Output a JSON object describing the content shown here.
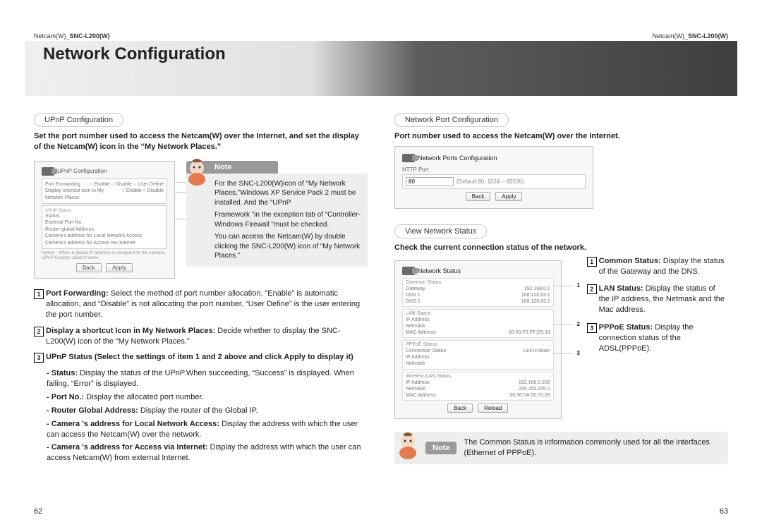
{
  "header": {
    "left_prefix": "Netcam(W)_",
    "left_model": "SNC-L200(W)",
    "right_prefix": "Netcam(W)_",
    "right_model": "SNC-L200(W)"
  },
  "banner": {
    "title": "Network Configuration"
  },
  "left": {
    "section_title": "UPnP Configuration",
    "intro": "Set the port number used to access the Netcam(W) over the Internet, and set the display of the Netcam(W) icon in the “My Network Places.”",
    "panel": {
      "title": "UPnP Configuration",
      "row1_l": "Port Forwarding",
      "row1_r": "○ Enable  ○ Disable  ○ User Define",
      "row2_l": "Display shortcut icon in My Network Places",
      "row2_r": "○ Enable  ○ Disable",
      "status_title": "UPnP Status",
      "s1": "Status",
      "s2": "External Port No.",
      "s3": "Router global Address",
      "s4": "Camera's address for Local Network Access",
      "s5": "Camera's address for Access via Internet",
      "notice": "Notice : When a global IP address is assigned to the camera, UPnP function doesn't work.",
      "btn_back": "Back",
      "btn_apply": "Apply"
    },
    "note": {
      "label": "Note",
      "p1": "For the SNC-L200(W)icon of “My Network Places,”Windows XP Service Pack 2 must be installed. And the “UPnP",
      "p2": "Framework ”in the exception tab of “Controller-Windows Firewall ”must be checked.",
      "p3": "You can access the Netcam(W) by double clicking the SNC-L200(W) icon of “My Network Places.”"
    },
    "list": {
      "i1_b": "Port Forwarding:",
      "i1_t": " Select the method of port number allocation. “Enable” is automatic allocation, and “Disable” is not allocating the port number. “User Define” is the user entering the port number.",
      "i2_b": "Display a shortcut Icon in My Network Places:",
      "i2_t": " Decide whether to display the SNC-L200(W) icon of the “My Network Places.”",
      "i3_b": "UPnP Status (Select the settings of item 1 and 2 above and click Apply to display it)",
      "s1_b": "Status:",
      "s1_t": " Display the status of the UPnP.When succeeding, “Success” is displayed. When failing, “Error” is displayed.",
      "s2_b": "Port No.:",
      "s2_t": " Display the allocated port number.",
      "s3_b": "Router Global Address:",
      "s3_t": " Display the router of the Global IP.",
      "s4_b": "Camera 's address for Local Network Access:",
      "s4_t": " Display the address with which the user can access the Netcam(W) over the network.",
      "s5_b": "Camera 's address for Access via Internet:",
      "s5_t": " Display the address with which the user can access Netcam(W) from external Internet."
    },
    "callouts": {
      "n1": "1",
      "n2": "2",
      "n3": "3"
    }
  },
  "right": {
    "port_title": "Network Port Configuration",
    "port_intro": "Port number used to access the Netcam(W) over the Internet.",
    "port_panel": {
      "title": "Network Ports Configuration",
      "http": "HTTP Port",
      "value": "80",
      "default": "(Default:80, 1024 ~ 65535)",
      "btn_back": "Back",
      "btn_apply": "Apply"
    },
    "view_title": "View Network Status",
    "view_intro": "Check the current connection status of the network.",
    "status_panel": {
      "title": "Network Status",
      "g1": "Common Status",
      "g1_gw": "Gateway",
      "g1_gw_v": "192.168.0.1",
      "g1_d1": "DNS 1",
      "g1_d1_v": "168.126.63.1",
      "g1_d2": "DNS 2",
      "g1_d2_v": "168.126.63.2",
      "g2": "LAN Status",
      "g2_ip": "IP Address",
      "g2_ip_v": "",
      "g2_nm": "Netmask",
      "g2_nm_v": "",
      "g2_mac": "MAC Address",
      "g2_mac_v": "00:00:F0:FF:D5:33",
      "g3": "PPPoE Status",
      "g3_cs": "Connection Status",
      "g3_cs_v": "Link is down",
      "g3_ip": "IP Address",
      "g3_nm": "Netmask",
      "g4": "Wireless LAN Status",
      "g4_ip": "IP Address",
      "g4_ip_v": "192.168.0.200",
      "g4_nm": "Netmask",
      "g4_nm_v": "255.255.255.0",
      "g4_mac": "MAC Address",
      "g4_mac_v": "00:30:0A:00:70:26",
      "btn_back": "Back",
      "btn_reload": "Reload"
    },
    "items": {
      "i1_b": "Common Status:",
      "i1_t": " Display the status of the Gateway and the DNS.",
      "i2_b": "LAN Status:",
      "i2_t": " Display the status of the IP address, the Netmask and the Mac address.",
      "i3_b": "PPPoE Status:",
      "i3_t": " Display the connection status of the ADSL(PPPoE)."
    },
    "callouts": {
      "n1": "1",
      "n2": "2",
      "n3": "3"
    },
    "note2": {
      "label": "Note",
      "body": "The Common Status is information commonly used for all the interfaces (Ethernet of PPPoE)."
    }
  },
  "footer": {
    "left": "62",
    "right": "63"
  }
}
